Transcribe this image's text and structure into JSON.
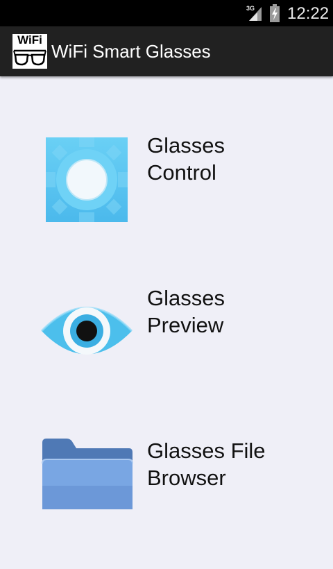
{
  "status_bar": {
    "network_label": "3G",
    "time": "12:22",
    "icons": [
      "signal-icon",
      "battery-charging-icon"
    ]
  },
  "action_bar": {
    "app_icon_text": "WiFi",
    "title": "WiFi Smart Glasses"
  },
  "menu": {
    "items": [
      {
        "label": "Glasses\nControl",
        "icon": "gear-icon"
      },
      {
        "label": "Glasses\nPreview",
        "icon": "eye-icon"
      },
      {
        "label": "Glasses File\nBrowser",
        "icon": "folder-icon"
      }
    ]
  },
  "colors": {
    "background": "#efeff7",
    "action_bar": "#212121",
    "gear": "#5cc7f2",
    "eye": "#4fc0ec",
    "folder": "#6f99d6"
  }
}
